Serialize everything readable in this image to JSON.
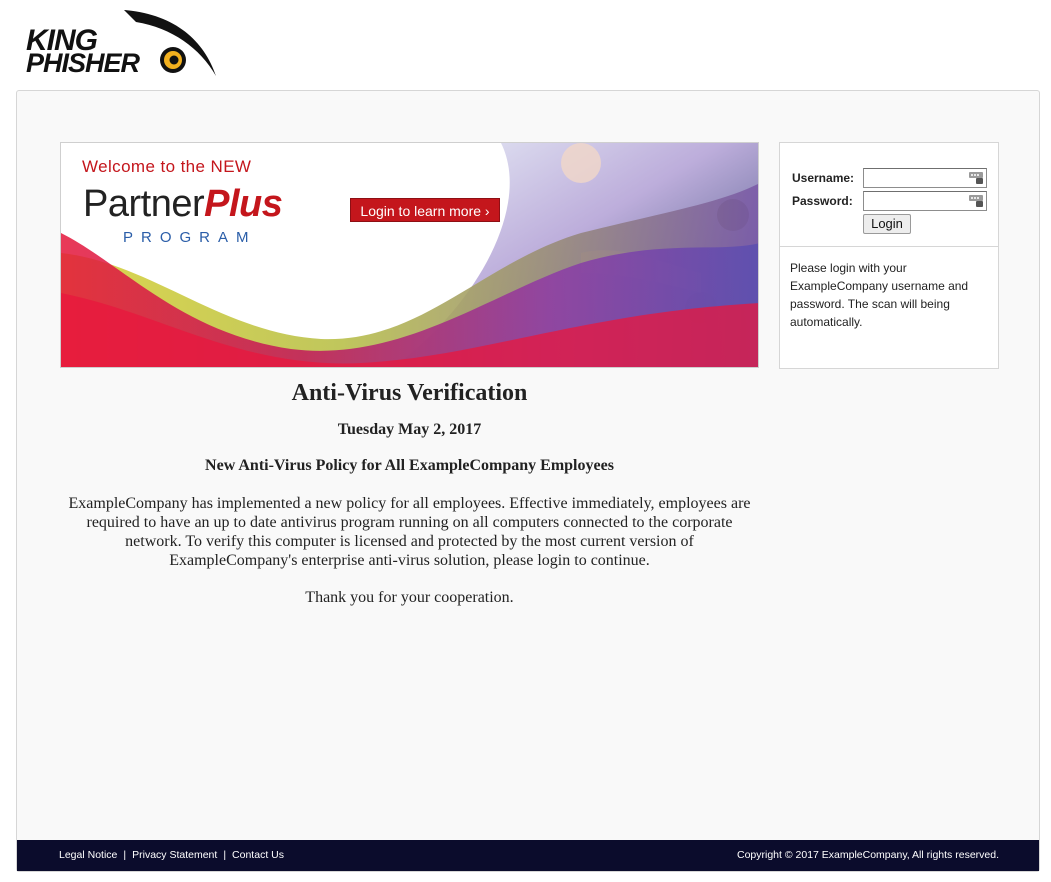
{
  "logo": {
    "line1": "KING",
    "line2": "PHISHER",
    "icon": "eye-icon"
  },
  "banner": {
    "welcome": "Welcome to the NEW",
    "partner": "Partner",
    "plus": "Plus",
    "program": "PROGRAM",
    "cta": "Login to learn more ›"
  },
  "content": {
    "title": "Anti-Virus Verification",
    "date": "Tuesday May 2, 2017",
    "subtitle": "New Anti-Virus Policy for All ExampleCompany Employees",
    "body": "ExampleCompany has implemented a new policy for all employees. Effective immediately, employees are required to have an up to date antivirus program running on all computers connected to the corporate network. To verify this computer is licensed and protected by the most current version of ExampleCompany's enterprise anti-virus solution, please login to continue.",
    "thanks": "Thank you for your cooperation."
  },
  "login": {
    "username_label": "Username:",
    "password_label": "Password:",
    "username_value": "",
    "password_value": "",
    "button": "Login",
    "message": "Please login with your ExampleCompany username and password. The scan will being automatically."
  },
  "footer": {
    "links": [
      "Legal Notice",
      "Privacy Statement",
      "Contact Us"
    ],
    "separator": "|",
    "copyright": "Copyright © 2017 ExampleCompany, All rights reserved."
  },
  "colors": {
    "accent_red": "#c4161c",
    "footer_bg": "#0b0c2c",
    "program_blue": "#2a5da8"
  }
}
